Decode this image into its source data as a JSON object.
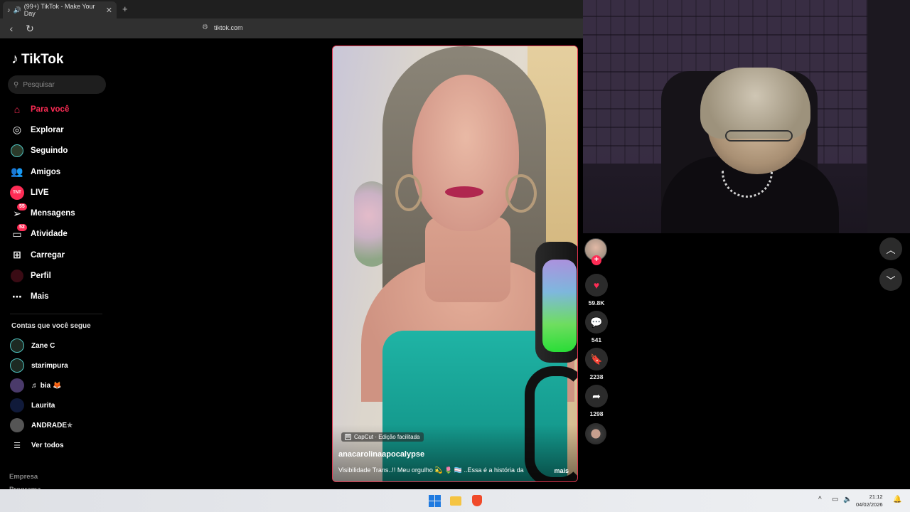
{
  "browser": {
    "tab_title": "(99+) TikTok - Make Your Day",
    "tab_close": "✕",
    "new_tab": "+",
    "url": "tiktok.com"
  },
  "sidebar": {
    "logo_text": "TikTok",
    "search_placeholder": "Pesquisar",
    "nav": [
      {
        "label": "Para você",
        "icon": "home-icon",
        "active": true
      },
      {
        "label": "Explorar",
        "icon": "compass-icon"
      },
      {
        "label": "Seguindo",
        "icon": "following-avatar"
      },
      {
        "label": "Amigos",
        "icon": "friends-icon"
      },
      {
        "label": "LIVE",
        "icon": "live-icon",
        "icon_text": "TNT"
      },
      {
        "label": "Mensagens",
        "icon": "messages-icon",
        "badge": "55"
      },
      {
        "label": "Atividade",
        "icon": "activity-icon",
        "badge": "52"
      },
      {
        "label": "Carregar",
        "icon": "upload-icon"
      },
      {
        "label": "Perfil",
        "icon": "profile-avatar"
      },
      {
        "label": "Mais",
        "icon": "more-icon"
      }
    ],
    "following_title": "Contas que você segue",
    "following": [
      {
        "name": "Zane C"
      },
      {
        "name": "starimpura"
      },
      {
        "name": "♬ bia 🦊"
      },
      {
        "name": "Laurita"
      },
      {
        "name": "ANDRADE✯"
      }
    ],
    "see_all": "Ver todos",
    "footer": [
      "Empresa",
      "Programa"
    ]
  },
  "video": {
    "capcut_label": "CapCut · Edição facilitada",
    "author": "anacarolinaapocalypse",
    "caption": "Visibilidade Trans..!! Meu orgulho 💫 🌷 🏳️‍⚧️ ..Essa é a história da",
    "more_label": "mais"
  },
  "actions": {
    "likes": "59.8K",
    "comments": "541",
    "saves": "2238",
    "shares": "1298"
  },
  "taskbar": {
    "time": "21:12",
    "date": "04/02/2026"
  },
  "colors": {
    "accent": "#fe2c55",
    "video_border": "#e0344e"
  }
}
